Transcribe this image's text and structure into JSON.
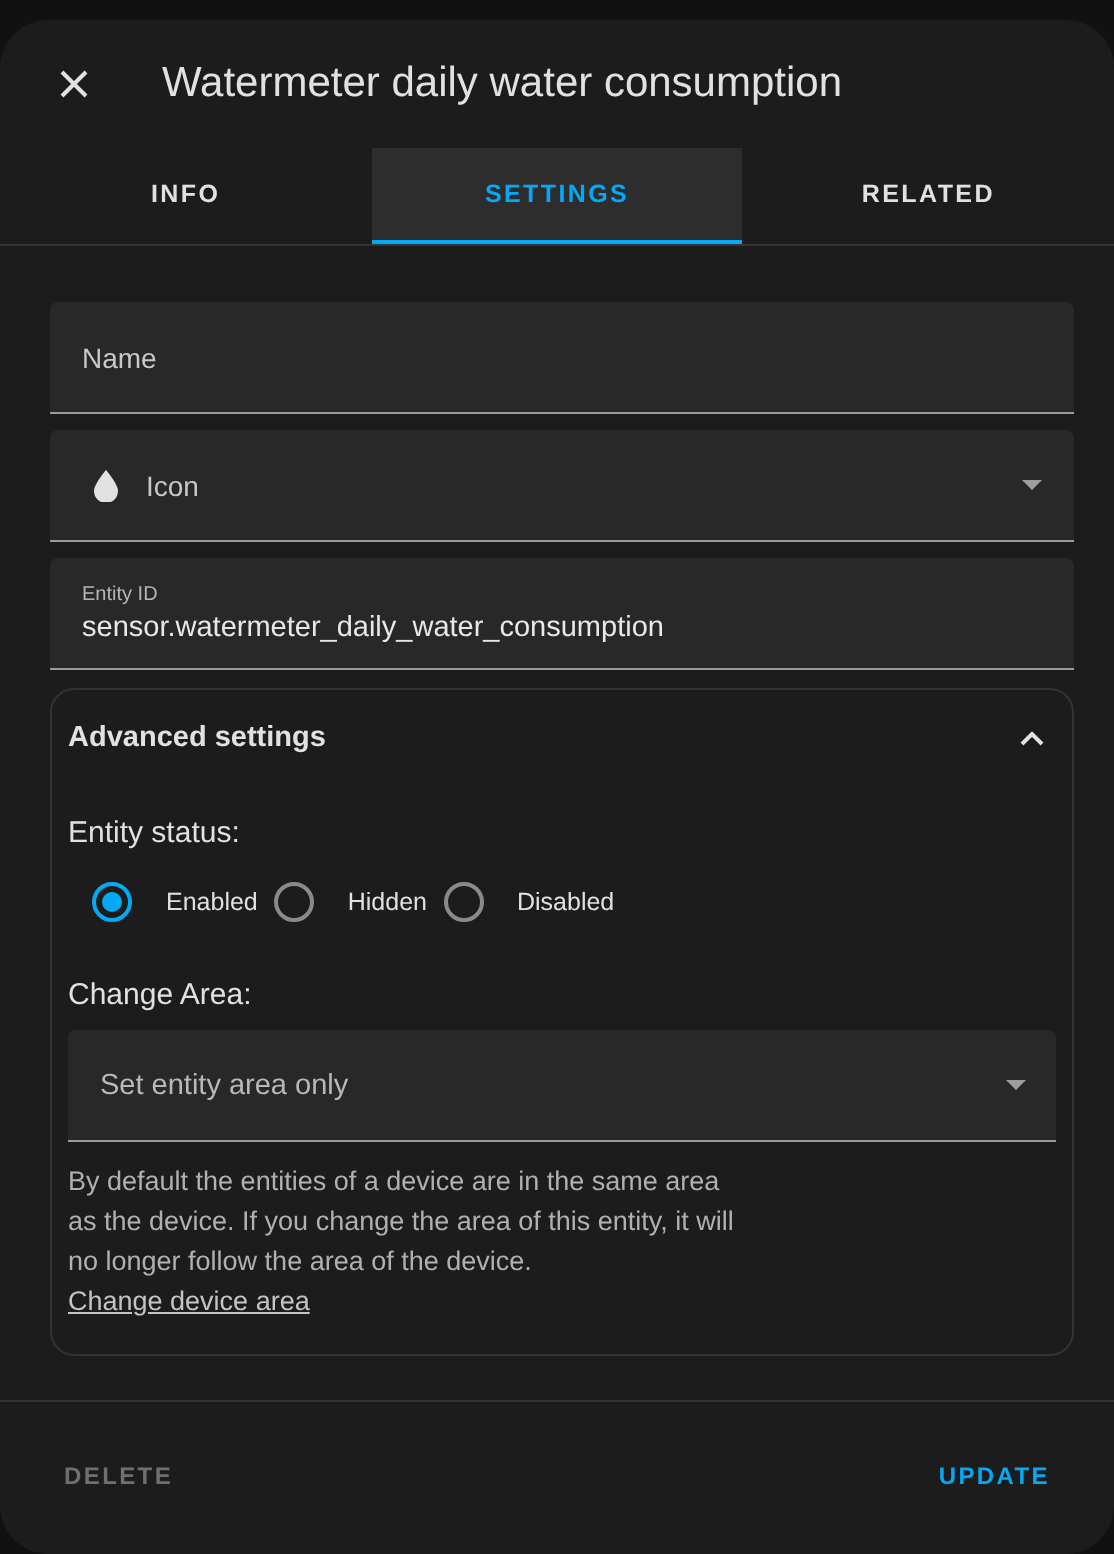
{
  "dialog": {
    "title": "Watermeter daily water consumption"
  },
  "tabs": [
    {
      "label": "INFO",
      "selected": false
    },
    {
      "label": "SETTINGS",
      "selected": true
    },
    {
      "label": "RELATED",
      "selected": false
    }
  ],
  "fields": [
    {
      "kind": "text",
      "label": "Name"
    },
    {
      "kind": "icon-picker",
      "label": "Icon"
    },
    {
      "kind": "filled",
      "label": "Entity ID",
      "value": "sensor.watermeter_daily_water_consumption"
    }
  ],
  "advanced": {
    "title": "Advanced settings",
    "expanded": true,
    "status_label": "Entity status:",
    "status_options": [
      {
        "label": "Enabled",
        "selected": true
      },
      {
        "label": "Hidden",
        "selected": false
      },
      {
        "label": "Disabled",
        "selected": false
      }
    ],
    "area_label": "Change Area:",
    "area_select": "Set entity area only",
    "help_text": "By default the entities of a device are in the same area as the device. If you change the area of this entity, it will no longer follow the area of the device.",
    "help_link": "Change device area"
  },
  "buttons": {
    "delete": {
      "label": "DELETE",
      "disabled": true
    },
    "update": {
      "label": "UPDATE",
      "disabled": false
    }
  }
}
